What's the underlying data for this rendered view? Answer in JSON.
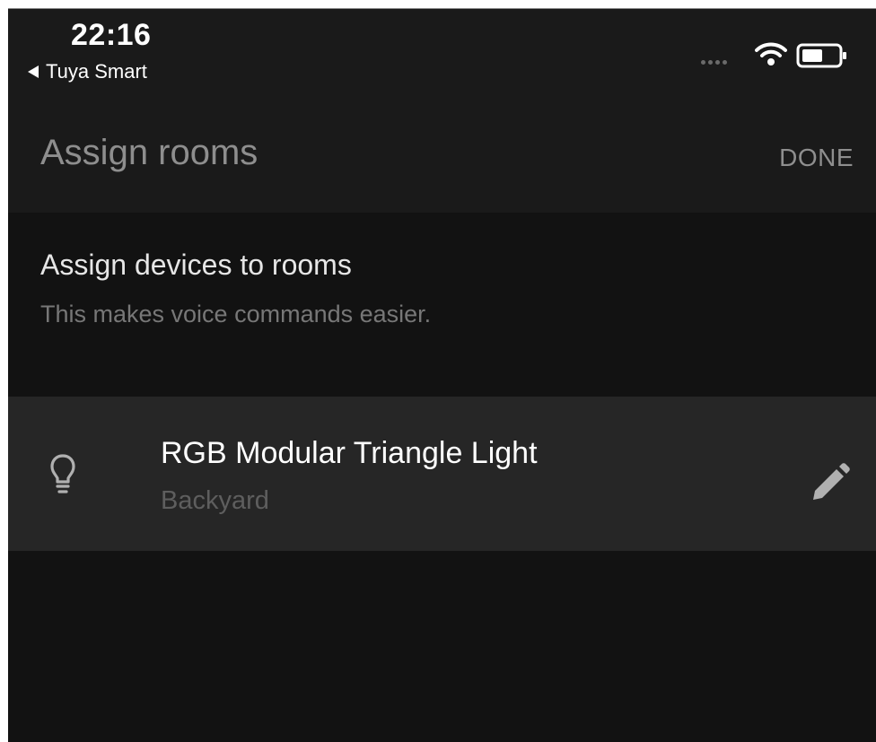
{
  "status_bar": {
    "time": "22:16",
    "back_app": "Tuya Smart",
    "icons": [
      "signal-dots-icon",
      "wifi-icon",
      "battery-icon"
    ]
  },
  "app_bar": {
    "title": "Assign rooms",
    "done_label": "DONE"
  },
  "section": {
    "title": "Assign devices to rooms",
    "subtitle": "This makes voice commands easier."
  },
  "devices": [
    {
      "icon": "lightbulb-icon",
      "name": "RGB Modular Triangle Light",
      "room": "Backyard",
      "action_icon": "pencil-edit-icon"
    }
  ],
  "colors": {
    "background": "#121212",
    "app_bar": "#1a1a1a",
    "row": "#262626",
    "muted_text": "#8e8e8e",
    "room_text": "#5e5e5e",
    "icon": "#b0b0b0"
  }
}
